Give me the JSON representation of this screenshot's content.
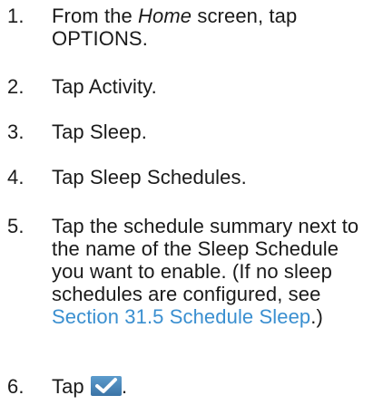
{
  "steps": [
    {
      "number": "1.",
      "a": "From the ",
      "em": "Home",
      "b": " screen, tap",
      "c": "OPTIONS."
    },
    {
      "number": "2.",
      "a": "Tap ",
      "b": "Activity",
      "c": "."
    },
    {
      "number": "3.",
      "a": "Tap ",
      "b": "Sleep",
      "c": "."
    },
    {
      "number": "4.",
      "a": "Tap ",
      "b": "Sleep Schedules",
      "c": "."
    },
    {
      "number": "5.",
      "lines": [
        "Tap the schedule summary next to",
        "the name of the Sleep Schedule",
        "you want to enable. (If no sleep",
        "schedules are configured, see"
      ],
      "link": "Section 31.5 Schedule Sleep",
      "after_link": ".)"
    },
    {
      "number": "6.",
      "a": "Tap ",
      "icon": "checkmark-ok-icon",
      "c": "."
    }
  ],
  "colors": {
    "text": "#1a1a1a",
    "link": "#3a8fd0",
    "icon_bg": "#4a87b8",
    "icon_check": "#ffffff"
  }
}
